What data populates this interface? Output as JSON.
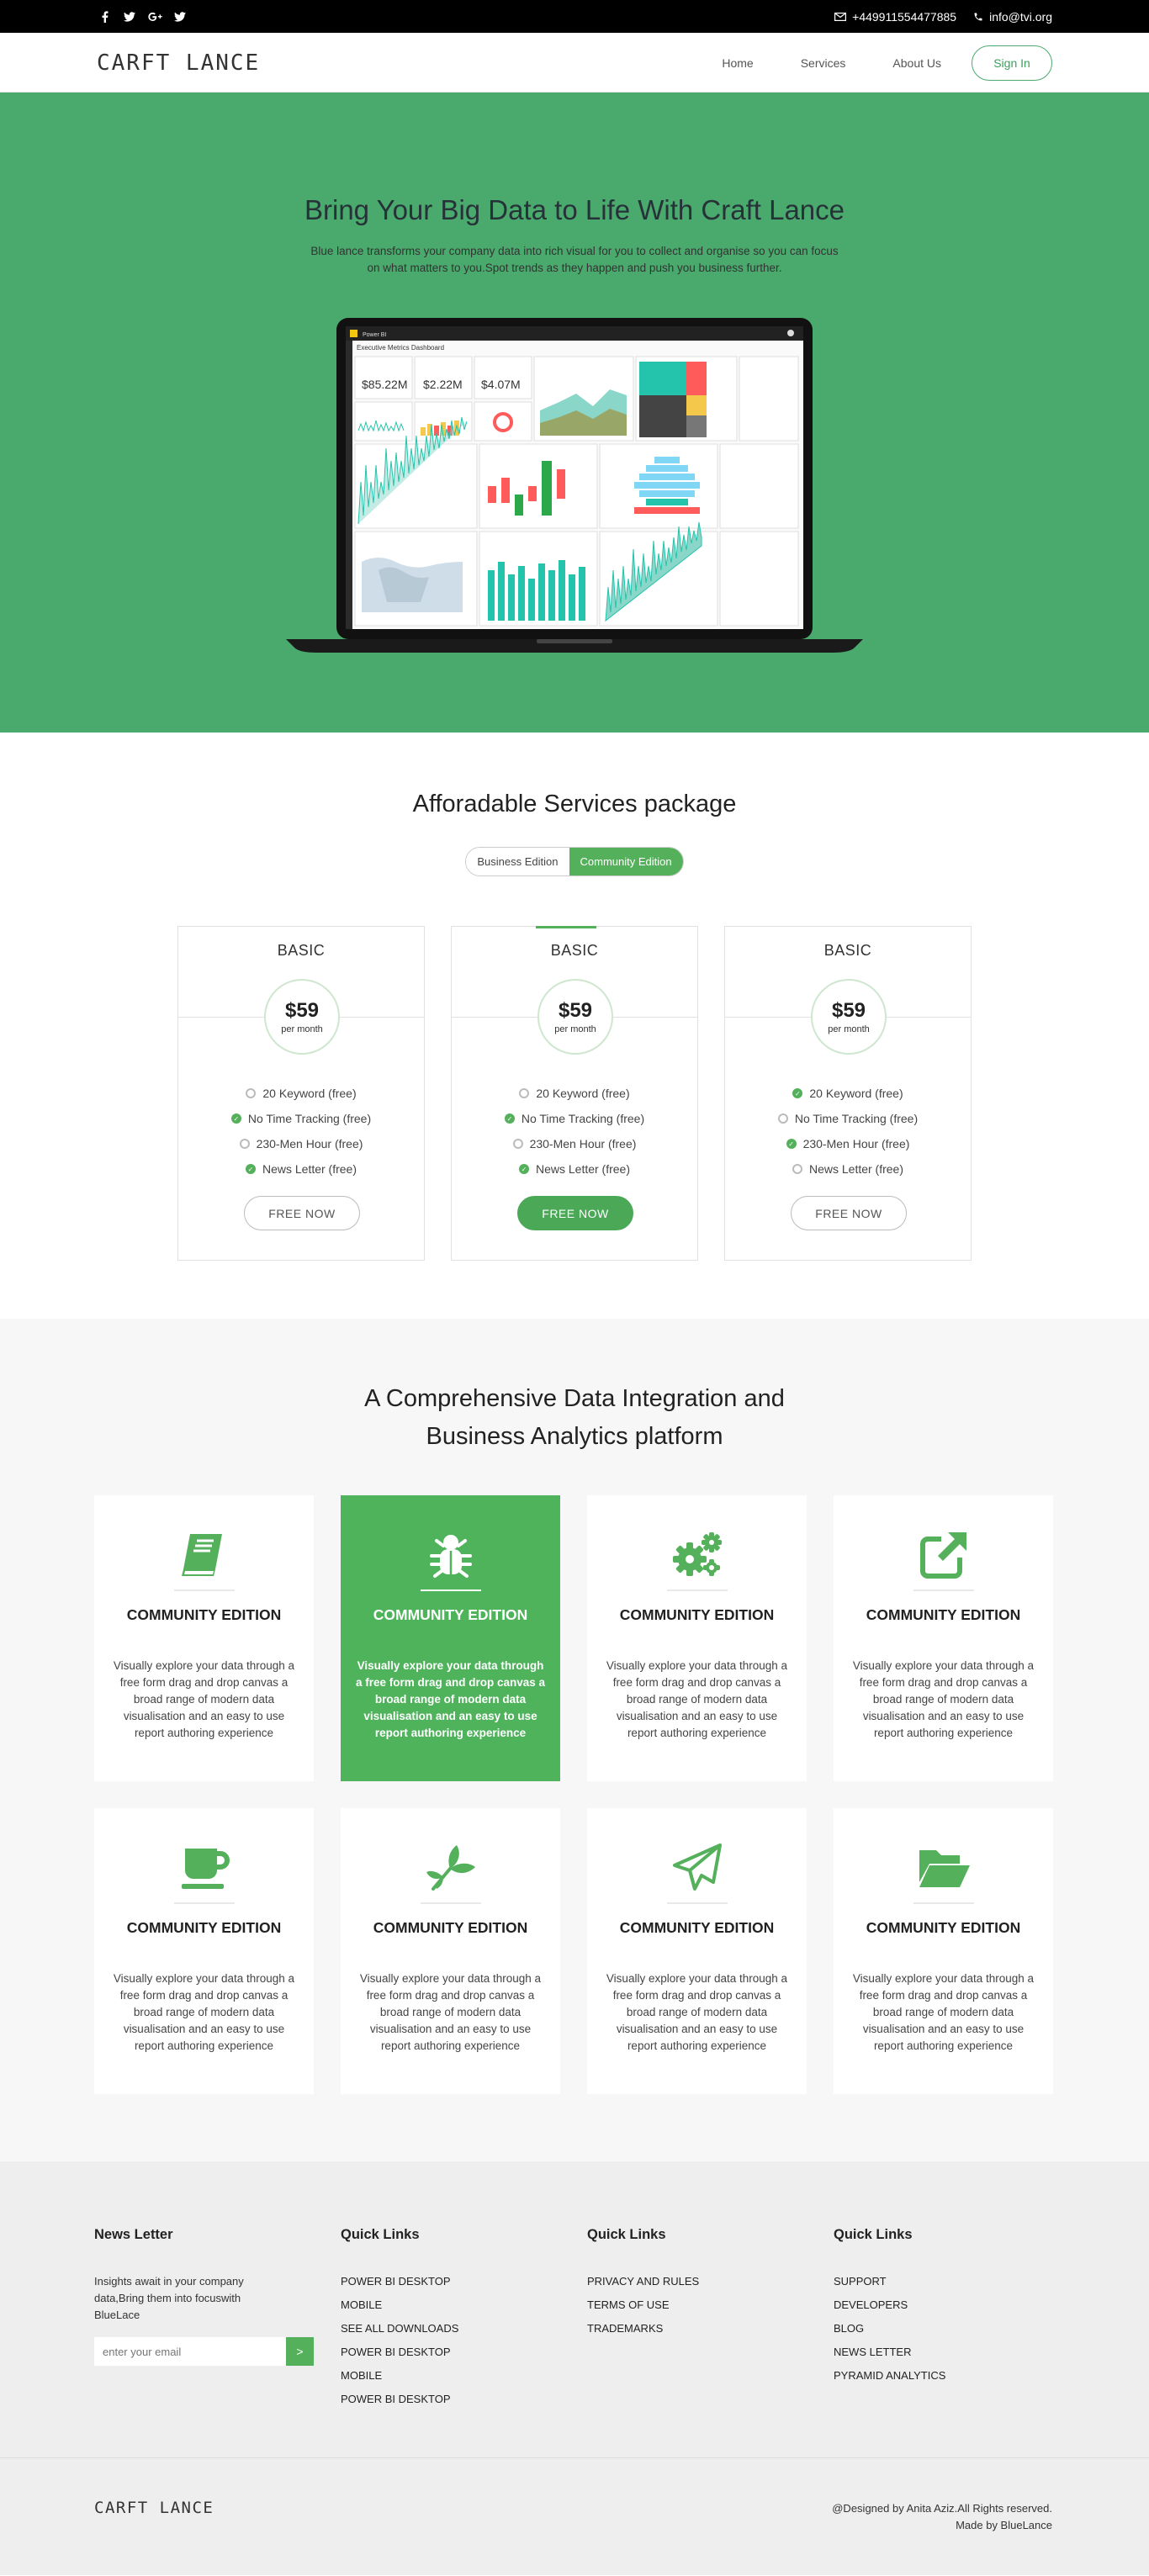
{
  "topbar": {
    "social": [
      "facebook-icon",
      "twitter-icon",
      "google-plus-icon",
      "twitter-icon"
    ],
    "phone": "+449911554477885",
    "email": "info@tvi.org"
  },
  "header": {
    "logo": "CARFT LANCE",
    "nav": [
      "Home",
      "Services",
      "About Us"
    ],
    "signin": "Sign In"
  },
  "hero": {
    "title": "Bring Your Big Data to Life With Craft Lance",
    "text": "Blue lance transforms your company data into rich visual for you to collect and organise so you can focus on what matters to you.Spot trends as they happen and push you business further.",
    "dashboard": {
      "app_name": "Power BI",
      "title": "Executive Metrics Dashboard",
      "kpis": [
        "$85.22M",
        "$2.22M",
        "$4.07M"
      ]
    }
  },
  "pricing": {
    "title": "Afforadable Services package",
    "toggle": {
      "off": "Business Edition",
      "on": "Community Edition"
    },
    "plans": [
      {
        "name": "BASIC",
        "price": "$59",
        "per": "per month",
        "button": "FREE NOW",
        "features": [
          {
            "label": "20 Keyword (free)",
            "checked": false
          },
          {
            "label": "No Time Tracking (free)",
            "checked": true
          },
          {
            "label": "230-Men Hour (free)",
            "checked": false
          },
          {
            "label": "News Letter (free)",
            "checked": true
          }
        ]
      },
      {
        "name": "BASIC",
        "price": "$59",
        "per": "per month",
        "button": "FREE NOW",
        "features": [
          {
            "label": "20 Keyword (free)",
            "checked": false
          },
          {
            "label": "No Time Tracking (free)",
            "checked": true
          },
          {
            "label": "230-Men Hour (free)",
            "checked": false
          },
          {
            "label": "News Letter (free)",
            "checked": true
          }
        ]
      },
      {
        "name": "BASIC",
        "price": "$59",
        "per": "per month",
        "button": "FREE NOW",
        "features": [
          {
            "label": "20 Keyword (free)",
            "checked": true
          },
          {
            "label": "No Time Tracking (free)",
            "checked": false
          },
          {
            "label": "230-Men Hour (free)",
            "checked": true
          },
          {
            "label": "News Letter (free)",
            "checked": false
          }
        ]
      }
    ]
  },
  "features": {
    "title_line1": "A Comprehensive Data Integration and",
    "title_line2": "Business Analytics platform",
    "cards": [
      {
        "icon": "book-icon",
        "title": "COMMUNITY EDITION",
        "text": "Visually explore your data through a free form drag and drop canvas a broad range of modern data visualisation and an easy to use report authoring experience"
      },
      {
        "icon": "bug-icon",
        "title": "COMMUNITY EDITION",
        "text": "Visually explore your data through a free form drag and drop canvas a broad range of modern data visualisation and an easy to use report authoring experience"
      },
      {
        "icon": "gears-icon",
        "title": "COMMUNITY EDITION",
        "text": "Visually explore your data through a free form drag and drop canvas a broad range of modern data visualisation and an easy to use report authoring experience"
      },
      {
        "icon": "external-link-icon",
        "title": "COMMUNITY EDITION",
        "text": "Visually explore your data through a free form drag and drop canvas a broad range of modern data visualisation and an easy to use report authoring experience"
      },
      {
        "icon": "coffee-icon",
        "title": "COMMUNITY EDITION",
        "text": "Visually explore your data through a free form drag and drop canvas a broad range of modern data visualisation and an easy to use report authoring experience"
      },
      {
        "icon": "leaf-icon",
        "title": "COMMUNITY EDITION",
        "text": "Visually explore your data through a free form drag and drop canvas a broad range of modern data visualisation and an easy to use report authoring experience"
      },
      {
        "icon": "paper-plane-icon",
        "title": "COMMUNITY EDITION",
        "text": "Visually explore your data through a free form drag and drop canvas a broad range of modern data visualisation and an easy to use report authoring experience"
      },
      {
        "icon": "folder-open-icon",
        "title": "COMMUNITY EDITION",
        "text": "Visually explore your data through a free form drag and drop canvas a broad range of modern data visualisation and an easy to use report authoring experience"
      }
    ]
  },
  "footer": {
    "newsletter": {
      "title": "News Letter",
      "text": "Insights await in your company data,Bring them into focuswith BlueLace",
      "placeholder": "enter your email",
      "button": ">"
    },
    "columns": [
      {
        "title": "Quick Links",
        "links": [
          "POWER BI DESKTOP",
          "MOBILE",
          "SEE ALL DOWNLOADS",
          "POWER BI DESKTOP",
          "MOBILE",
          "POWER BI DESKTOP"
        ]
      },
      {
        "title": "Quick Links",
        "links": [
          "PRIVACY AND RULES",
          "TERMS OF USE",
          "TRADEMARKS"
        ]
      },
      {
        "title": "Quick Links",
        "links": [
          "SUPPORT",
          "DEVELOPERS",
          "BLOG",
          "NEWS LETTER",
          "PYRAMID ANALYTICS"
        ]
      }
    ],
    "bottom_logo": "CARFT LANCE",
    "copyright": "@Designed by Anita Aziz.All Rights reserved.",
    "made_by": "Made by BlueLance"
  },
  "colors": {
    "accent": "#4aa96c",
    "green_button": "#55b05b",
    "topbar": "#000000"
  }
}
